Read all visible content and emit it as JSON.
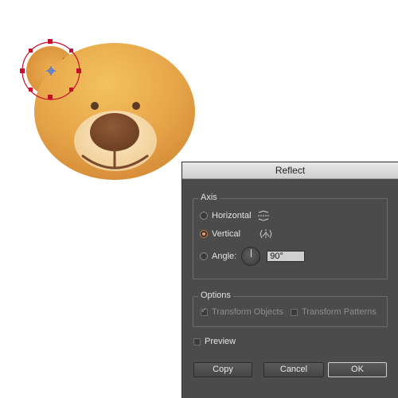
{
  "dialog": {
    "title": "Reflect",
    "axis": {
      "legend": "Axis",
      "horizontal_label": "Horizontal",
      "vertical_label": "Vertical",
      "angle_label": "Angle:",
      "angle_value": "90°",
      "selected": "vertical"
    },
    "options": {
      "legend": "Options",
      "transform_objects_label": "Transform Objects",
      "transform_patterns_label": "Transform Patterns"
    },
    "preview_label": "Preview",
    "buttons": {
      "copy": "Copy",
      "cancel": "Cancel",
      "ok": "OK"
    }
  },
  "colors": {
    "bear_fur": "#e5a34a",
    "bear_fur_light": "#f2c063",
    "muzzle": "#f6d9a9",
    "nose": "#7b4a2c",
    "selection": "#c8102e",
    "dialog_bg": "#4b4b4b"
  }
}
